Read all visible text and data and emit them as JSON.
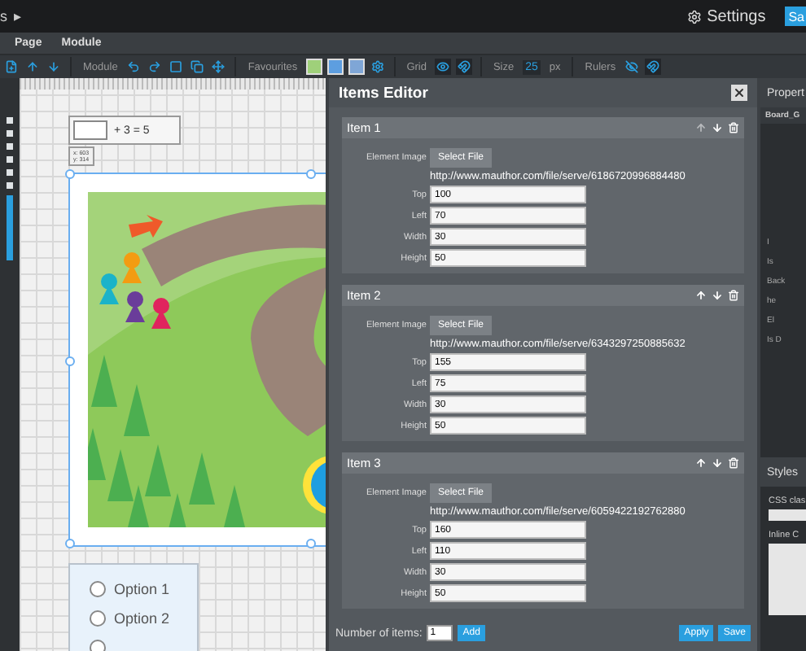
{
  "top_bar": {
    "breadcrumb": "s",
    "breadcrumb_arrow": "▸",
    "settings": "Settings",
    "save": "Sa"
  },
  "menu": [
    {
      "label": "Page"
    },
    {
      "label": "Module"
    }
  ],
  "toolbar": {
    "module_label": "Module",
    "favourites_label": "Favourites",
    "grid_label": "Grid",
    "grid_visible": true,
    "size_label": "Size",
    "size_value": "25",
    "size_unit": "px",
    "rulers_label": "Rulers",
    "rulers_visible": false
  },
  "canvas": {
    "equation": {
      "text": "+ 3 = 5"
    },
    "coords": [
      "x: 603",
      "y: 314"
    ],
    "options": [
      {
        "label": "Option 1",
        "selected": false
      },
      {
        "label": "Option 2",
        "selected": false
      }
    ]
  },
  "items_editor": {
    "title": "Items Editor",
    "items": [
      {
        "title": "Item 1",
        "image_label": "Element Image",
        "button": "Select File",
        "url": "http://www.mauthor.com/file/serve/6186720996884480",
        "fields": [
          {
            "label": "Top",
            "value": "100"
          },
          {
            "label": "Left",
            "value": "70"
          },
          {
            "label": "Width",
            "value": "30"
          },
          {
            "label": "Height",
            "value": "50"
          }
        ]
      },
      {
        "title": "Item 2",
        "image_label": "Element Image",
        "button": "Select File",
        "url": "http://www.mauthor.com/file/serve/6343297250885632",
        "fields": [
          {
            "label": "Top",
            "value": "155"
          },
          {
            "label": "Left",
            "value": "75"
          },
          {
            "label": "Width",
            "value": "30"
          },
          {
            "label": "Height",
            "value": "50"
          }
        ]
      },
      {
        "title": "Item 3",
        "image_label": "Element Image",
        "button": "Select File",
        "url": "http://www.mauthor.com/file/serve/6059422192762880",
        "fields": [
          {
            "label": "Top",
            "value": "160"
          },
          {
            "label": "Left",
            "value": "110"
          },
          {
            "label": "Width",
            "value": "30"
          },
          {
            "label": "Height",
            "value": "50"
          }
        ]
      }
    ],
    "footer": {
      "count_label": "Number of items:",
      "count_value": "1",
      "add": "Add",
      "apply": "Apply",
      "save": "Save"
    }
  },
  "properties": {
    "title": "Propert",
    "subtitle": "Board_G",
    "labels": [
      "I",
      "Is",
      "Back",
      "he",
      "El",
      "Is D"
    ],
    "styles_title": "Styles",
    "css_label": "CSS clas",
    "inline_label": "Inline C"
  }
}
